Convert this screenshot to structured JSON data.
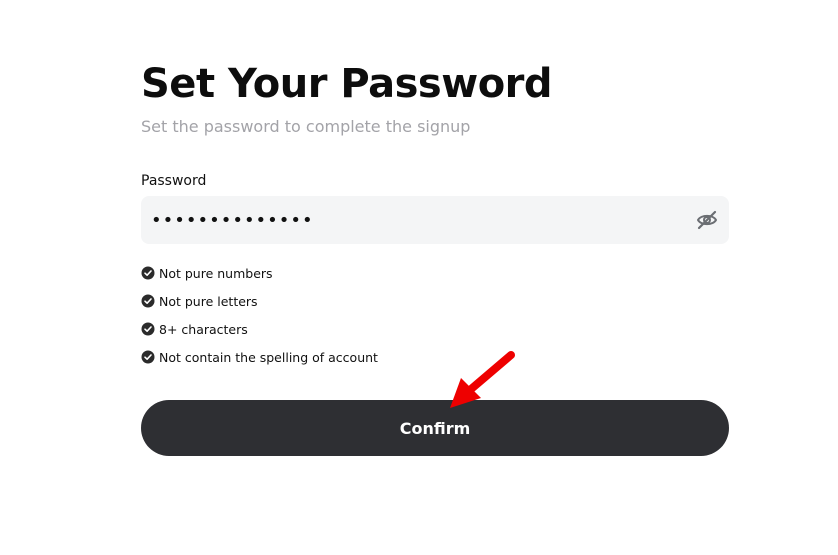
{
  "header": {
    "title": "Set Your Password",
    "subtitle": "Set the password to complete the signup"
  },
  "password": {
    "label": "Password",
    "value": "••••••••••••••",
    "toggle_icon": "eye-slash-icon"
  },
  "rules": [
    {
      "label": "Not pure numbers",
      "icon": "check-circle-icon"
    },
    {
      "label": "Not pure letters",
      "icon": "check-circle-icon"
    },
    {
      "label": "8+ characters",
      "icon": "check-circle-icon"
    },
    {
      "label": "Not contain the spelling of account",
      "icon": "check-circle-icon"
    }
  ],
  "confirm": {
    "label": "Confirm"
  },
  "colors": {
    "button_bg": "#2e2f33",
    "input_bg": "#f4f5f6",
    "subtitle": "#a3a3a8",
    "annotation_arrow": "#ee0000"
  }
}
